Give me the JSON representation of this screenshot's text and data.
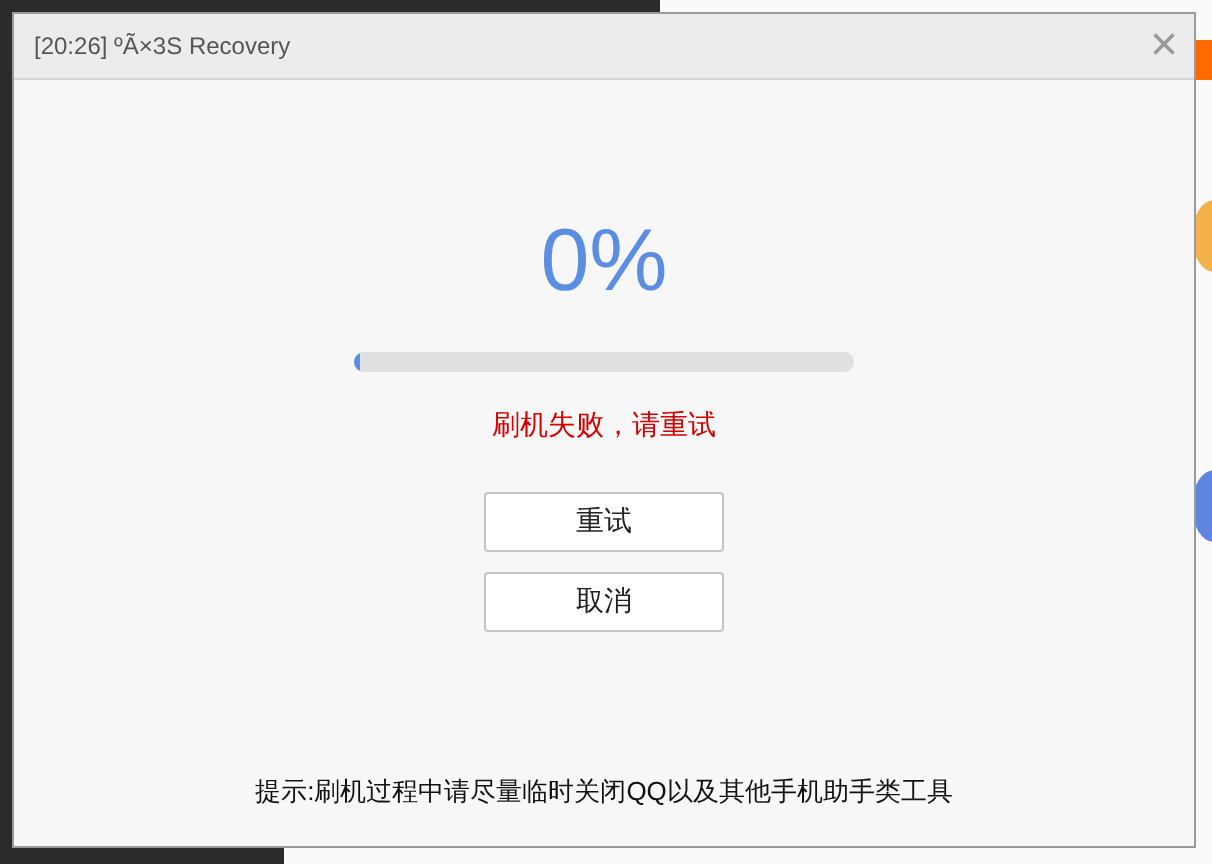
{
  "window": {
    "title": "[20:26] ºÃ×3S Recovery",
    "close": "×"
  },
  "progress": {
    "percent": "0%",
    "level": 0.01
  },
  "error": "刷机失败，请重试",
  "buttons": [
    "重试",
    "取消"
  ],
  "hint": "提示:刷机过程中请尽量临时关闭QQ以及其他手机助手类工具"
}
